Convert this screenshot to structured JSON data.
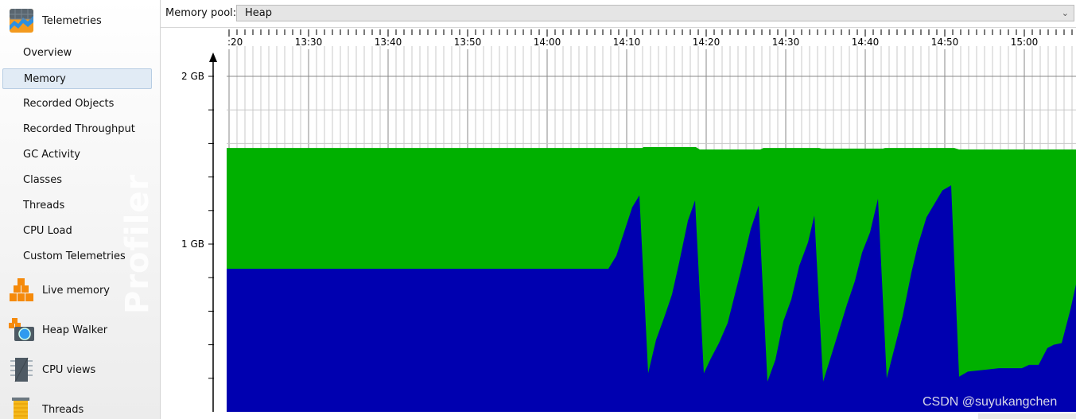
{
  "sidebar": {
    "telemetries": {
      "label": "Telemetries",
      "icon": "telemetries-icon"
    },
    "items": [
      {
        "label": "Overview"
      },
      {
        "label": "Memory",
        "selected": true
      },
      {
        "label": "Recorded Objects"
      },
      {
        "label": "Recorded Throughput"
      },
      {
        "label": "GC Activity"
      },
      {
        "label": "Classes"
      },
      {
        "label": "Threads"
      },
      {
        "label": "CPU Load"
      },
      {
        "label": "Custom Telemetries"
      }
    ],
    "sections": [
      {
        "label": "Live memory",
        "icon": "live-memory-cubes-icon"
      },
      {
        "label": "Heap Walker",
        "icon": "heap-walker-camera-icon"
      },
      {
        "label": "CPU views",
        "icon": "cpu-chip-icon"
      },
      {
        "label": "Threads",
        "icon": "threads-spool-icon"
      }
    ],
    "watermark": "Profiler"
  },
  "toolbar": {
    "memory_pool_label": "Memory pool:",
    "memory_pool_value": "Heap"
  },
  "watermark_text": "CSDN @suyukangchen",
  "colors": {
    "used": "#0000b0",
    "committed": "#00b000",
    "selected_bg": "#e1ebf5"
  },
  "chart_data": {
    "type": "area",
    "x_tick_labels": [
      ":20",
      "13:30",
      "13:40",
      "13:50",
      "14:00",
      "14:10",
      "14:20",
      "14:30",
      "14:40",
      "14:50",
      "15:00"
    ],
    "y_tick_labels": [
      "1 GB",
      "2 GB"
    ],
    "y_unit": "GB",
    "ylim": [
      0,
      2.1
    ],
    "xlim": [
      "13:19:42",
      "15:06:30"
    ],
    "grid": true,
    "series": [
      {
        "key": "committed",
        "color": "#00b000",
        "points": [
          [
            "13:19:42",
            1.573
          ],
          [
            "14:12:00",
            1.573
          ],
          [
            "14:12:06",
            1.578
          ],
          [
            "14:18:42",
            1.578
          ],
          [
            "14:19:12",
            1.564
          ],
          [
            "14:26:48",
            1.564
          ],
          [
            "14:27:12",
            1.573
          ],
          [
            "14:34:12",
            1.573
          ],
          [
            "14:34:30",
            1.569
          ],
          [
            "14:42:12",
            1.569
          ],
          [
            "14:42:30",
            1.573
          ],
          [
            "14:51:12",
            1.573
          ],
          [
            "14:51:48",
            1.564
          ],
          [
            "15:06:30",
            1.564
          ]
        ]
      },
      {
        "key": "used",
        "color": "#0000b0",
        "points": [
          [
            "13:19:42",
            0.853
          ],
          [
            "14:07:42",
            0.853
          ],
          [
            "14:08:42",
            0.93
          ],
          [
            "14:10:42",
            1.22
          ],
          [
            "14:11:36",
            1.29
          ],
          [
            "14:12:42",
            0.23
          ],
          [
            "14:13:42",
            0.43
          ],
          [
            "14:14:42",
            0.56
          ],
          [
            "14:15:42",
            0.7
          ],
          [
            "14:16:36",
            0.89
          ],
          [
            "14:17:42",
            1.14
          ],
          [
            "14:18:36",
            1.26
          ],
          [
            "14:19:42",
            0.23
          ],
          [
            "14:20:36",
            0.32
          ],
          [
            "14:21:36",
            0.41
          ],
          [
            "14:22:42",
            0.53
          ],
          [
            "14:24:18",
            0.83
          ],
          [
            "14:25:36",
            1.09
          ],
          [
            "14:26:36",
            1.23
          ],
          [
            "14:27:42",
            0.18
          ],
          [
            "14:28:42",
            0.31
          ],
          [
            "14:29:42",
            0.54
          ],
          [
            "14:30:42",
            0.67
          ],
          [
            "14:31:42",
            0.87
          ],
          [
            "14:32:48",
            1.01
          ],
          [
            "14:33:36",
            1.17
          ],
          [
            "14:34:42",
            0.18
          ],
          [
            "14:36:36",
            0.47
          ],
          [
            "14:37:42",
            0.64
          ],
          [
            "14:38:42",
            0.78
          ],
          [
            "14:39:36",
            0.95
          ],
          [
            "14:40:36",
            1.07
          ],
          [
            "14:41:36",
            1.27
          ],
          [
            "14:42:42",
            0.2
          ],
          [
            "14:44:42",
            0.57
          ],
          [
            "14:45:48",
            0.83
          ],
          [
            "14:46:36",
            0.99
          ],
          [
            "14:47:42",
            1.16
          ],
          [
            "14:49:42",
            1.32
          ],
          [
            "14:50:48",
            1.35
          ],
          [
            "14:51:48",
            0.21
          ],
          [
            "14:52:54",
            0.24
          ],
          [
            "14:54:54",
            0.25
          ],
          [
            "14:56:48",
            0.26
          ],
          [
            "14:59:42",
            0.26
          ],
          [
            "15:00:36",
            0.28
          ],
          [
            "15:01:48",
            0.28
          ],
          [
            "15:02:54",
            0.38
          ],
          [
            "15:03:42",
            0.4
          ],
          [
            "15:04:42",
            0.41
          ],
          [
            "15:05:48",
            0.61
          ],
          [
            "15:06:30",
            0.76
          ]
        ]
      }
    ]
  }
}
